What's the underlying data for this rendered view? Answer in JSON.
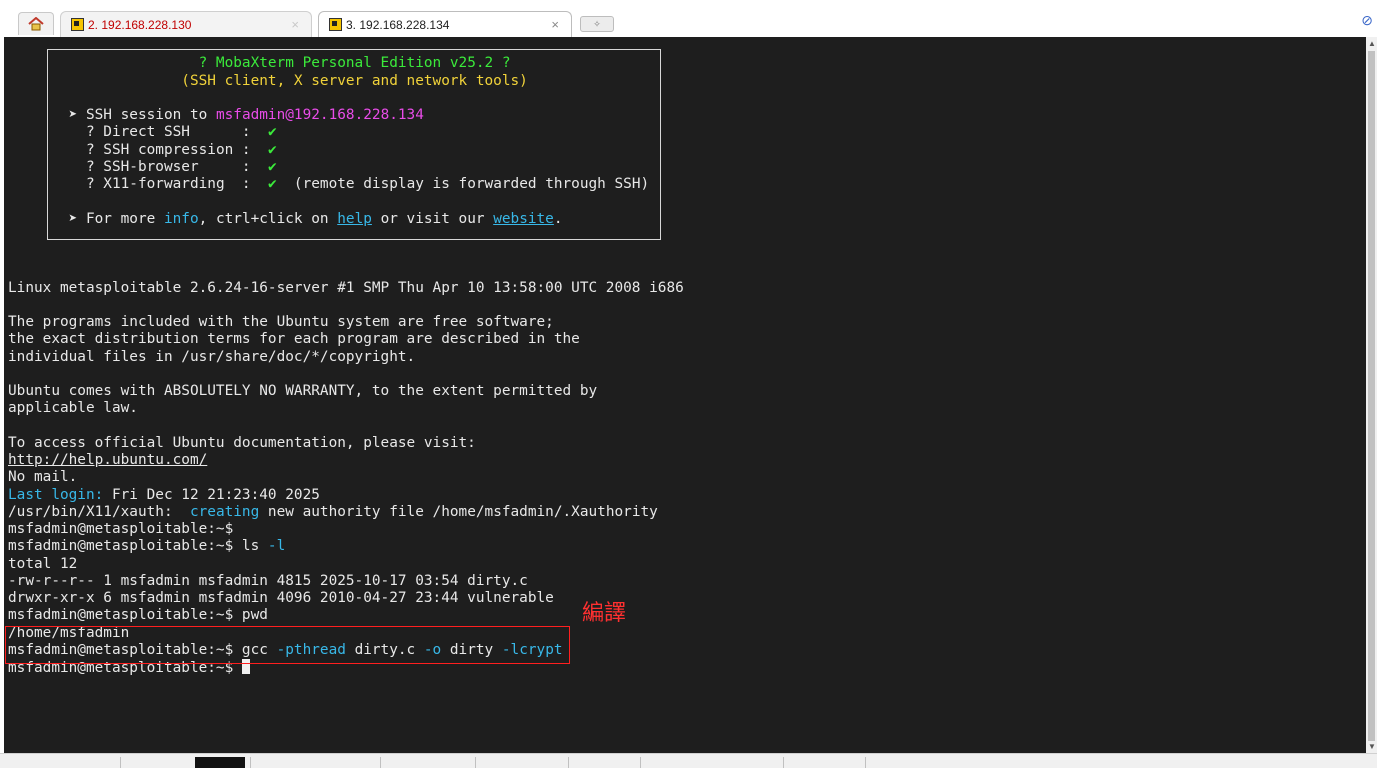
{
  "tabs": [
    {
      "label": "2. 192.168.228.130",
      "active": false,
      "close": "×"
    },
    {
      "label": "3. 192.168.228.134",
      "active": true,
      "close": "×"
    }
  ],
  "icons": {
    "home": "home-icon",
    "new_tab": "new-tab-icon",
    "attach": "paperclip-icon",
    "session": "ssh-terminal-icon"
  },
  "banner": {
    "title": "? MobaXterm Personal Edition v25.2 ?",
    "subtitle": "(SSH client, X server and network tools)",
    "session_prefix": "➤ SSH session to ",
    "session_target": "msfadmin@192.168.228.134",
    "features": [
      {
        "label": "  ? Direct SSH      :  ",
        "check": "✔",
        "note": ""
      },
      {
        "label": "  ? SSH compression :  ",
        "check": "✔",
        "note": ""
      },
      {
        "label": "  ? SSH-browser     :  ",
        "check": "✔",
        "note": ""
      },
      {
        "label": "  ? X11-forwarding  :  ",
        "check": "✔",
        "note": "  (remote display is forwarded through SSH)"
      }
    ],
    "more_prefix": "➤ For more ",
    "more_info": "info",
    "more_mid": ", ctrl+click on ",
    "more_help": "help",
    "more_or": " or visit our ",
    "more_website": "website",
    "more_end": "."
  },
  "terminal": {
    "uname": "Linux metasploitable 2.6.24-16-server #1 SMP Thu Apr 10 13:58:00 UTC 2008 i686",
    "motd1": "The programs included with the Ubuntu system are free software;",
    "motd2": "the exact distribution terms for each program are described in the",
    "motd3": "individual files in /usr/share/doc/*/copyright.",
    "warranty1": "Ubuntu comes with ABSOLUTELY NO WARRANTY, to the extent permitted by",
    "warranty2": "applicable law.",
    "docs": "To access official Ubuntu documentation, please visit:",
    "docs_url": "http://help.ubuntu.com/",
    "nomail": "No mail.",
    "last_login_label": "Last login:",
    "last_login_value": " Fri Dec 12 21:23:40 2025",
    "xauth_path": "/usr/bin/X11/xauth:  ",
    "xauth_creating": "creating",
    "xauth_rest": " new authority file /home/msfadmin/.Xauthority",
    "prompt": "msfadmin@metasploitable:~$",
    "cmd_ls": " ls ",
    "cmd_ls_flag": "-l",
    "ls_total": "total 12",
    "ls_row1": "-rw-r--r-- 1 msfadmin msfadmin 4815 2025-10-17 03:54 dirty.c",
    "ls_row2": "drwxr-xr-x 6 msfadmin msfadmin 4096 2010-04-27 23:44 vulnerable",
    "cmd_pwd": " pwd",
    "pwd_out": "/home/msfadmin",
    "cmd_gcc": " gcc ",
    "gcc_flag1": "-pthread",
    "gcc_file": " dirty.c ",
    "gcc_flag2": "-o",
    "gcc_out": " dirty ",
    "gcc_flag3": "-lcrypt"
  },
  "annotation": {
    "text": "編譯",
    "color": "#ff3030"
  },
  "colors": {
    "terminal_bg": "#1e1e1e",
    "text": "#e8e8e8",
    "green": "#3bea3b",
    "yellow": "#f0d23a",
    "magenta": "#e84ce8",
    "cyan": "#38b8e8",
    "highlight": "#ff1f1f"
  }
}
